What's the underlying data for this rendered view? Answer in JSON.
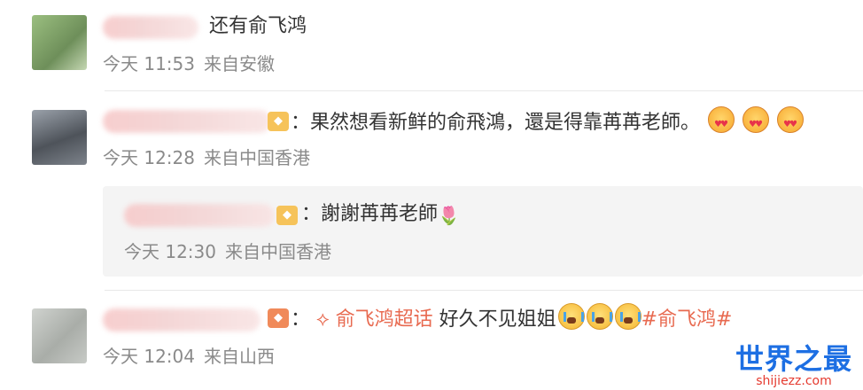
{
  "comments": [
    {
      "text": "还有俞飞鸿",
      "time": "今天 11:53",
      "location": "来自安徽",
      "avatar_color": "#8fae75"
    },
    {
      "text": "：果然想看新鲜的俞飛鴻，還是得靠苒苒老師。",
      "time": "今天 12:28",
      "location": "来自中国香港",
      "avatar_color": "#6b6f75"
    },
    {
      "text_prefix": "：",
      "topic": "俞飞鸿超话",
      "text": "好久不见姐姐",
      "hashtag": "#俞飞鸿#",
      "time": "今天 12:04",
      "location": "来自山西",
      "avatar_color": "#b8bcb8"
    }
  ],
  "reply": {
    "text": "：謝謝苒苒老師",
    "time": "今天 12:30",
    "location": "来自中国香港"
  },
  "icons": {
    "love_emoji": "love-face-emoji",
    "cry_emoji": "crying-face-emoji",
    "tulip": "tulip-emoji",
    "supertopic": "supertopic-icon"
  },
  "watermark": {
    "main": "世界之最",
    "sub": "shijiezz.com"
  }
}
